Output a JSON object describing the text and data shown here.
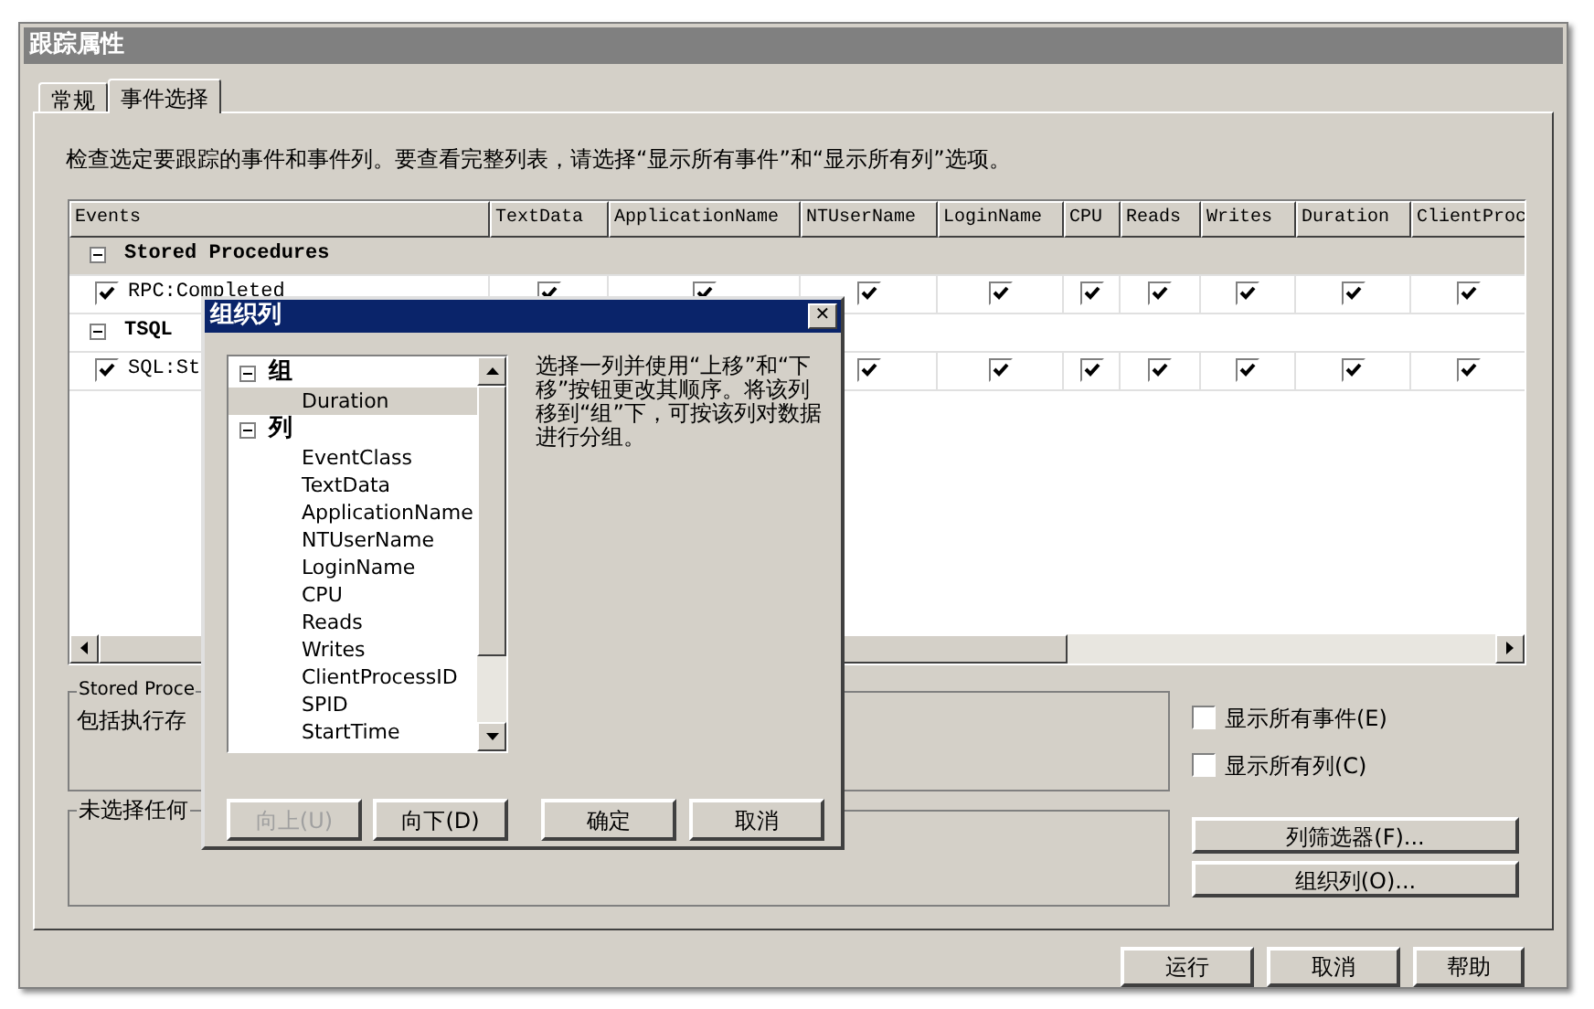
{
  "window": {
    "title": "跟踪属性"
  },
  "tabs": [
    {
      "label": "常规",
      "selected": false
    },
    {
      "label": "事件选择",
      "selected": true
    }
  ],
  "description": "检查选定要跟踪的事件和事件列。要查看完整列表，请选择“显示所有事件”和“显示所有列”选项。",
  "grid": {
    "columns": [
      "Events",
      "TextData",
      "ApplicationName",
      "NTUserName",
      "LoginName",
      "CPU",
      "Reads",
      "Writes",
      "Duration",
      "ClientProc"
    ],
    "rows": [
      {
        "kind": "group",
        "label": "Stored Procedures",
        "expanded": true
      },
      {
        "kind": "event",
        "label": "RPC:Completed",
        "checked": true,
        "cells": [
          true,
          true,
          true,
          true,
          true,
          true,
          true,
          true,
          true
        ]
      },
      {
        "kind": "group",
        "label": "TSQL",
        "expanded": true
      },
      {
        "kind": "event",
        "label": "SQL:St",
        "checked": true,
        "cells": [
          null,
          null,
          true,
          true,
          true,
          true,
          true,
          true,
          true
        ]
      }
    ]
  },
  "event_box": {
    "title": "Stored Proce",
    "text": "包括执行存"
  },
  "column_box": {
    "title": "未选择任何"
  },
  "options": [
    {
      "label": "显示所有事件(E)",
      "checked": false
    },
    {
      "label": "显示所有列(C)",
      "checked": false
    }
  ],
  "side_buttons": [
    "列筛选器(F)...",
    "组织列(O)..."
  ],
  "footer_buttons": [
    "运行",
    "取消",
    "帮助"
  ],
  "dialog": {
    "title": "组织列",
    "close": "✕",
    "tree": [
      {
        "label": "组",
        "expanded": true,
        "children": [
          {
            "label": "Duration",
            "selected": true
          }
        ]
      },
      {
        "label": "列",
        "expanded": true,
        "children": [
          {
            "label": "EventClass",
            "selected": false
          },
          {
            "label": "TextData",
            "selected": false
          },
          {
            "label": "ApplicationName",
            "selected": false
          },
          {
            "label": "NTUserName",
            "selected": false
          },
          {
            "label": "LoginName",
            "selected": false
          },
          {
            "label": "CPU",
            "selected": false
          },
          {
            "label": "Reads",
            "selected": false
          },
          {
            "label": "Writes",
            "selected": false
          },
          {
            "label": "ClientProcessID",
            "selected": false
          },
          {
            "label": "SPID",
            "selected": false
          },
          {
            "label": "StartTime",
            "selected": false
          }
        ]
      }
    ],
    "help": "选择一列并使用“上移”和“下移”按钮更改其顺序。将该列移到“组”下，可按该列对数据进行分组。",
    "buttons": [
      {
        "label": "向上(U)",
        "disabled": true
      },
      {
        "label": "向下(D)",
        "disabled": false
      },
      {
        "label": "确定",
        "disabled": false
      },
      {
        "label": "取消",
        "disabled": false
      }
    ]
  }
}
